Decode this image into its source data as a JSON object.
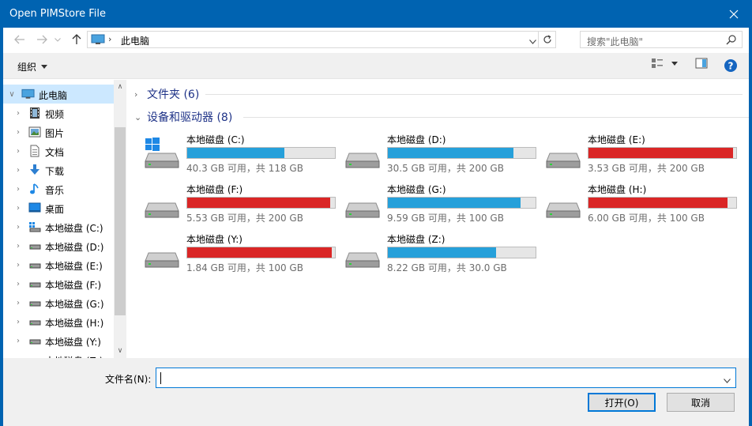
{
  "window": {
    "title": "Open PIMStore File"
  },
  "nav": {
    "path": "此电脑",
    "search_placeholder": "搜索\"此电脑\""
  },
  "toolbar": {
    "organize": "组织"
  },
  "sidebar": {
    "items": [
      {
        "label": "此电脑",
        "icon": "pc-icon",
        "expand": "open"
      },
      {
        "label": "视频",
        "icon": "video-icon"
      },
      {
        "label": "图片",
        "icon": "picture-icon"
      },
      {
        "label": "文档",
        "icon": "document-icon"
      },
      {
        "label": "下载",
        "icon": "download-icon"
      },
      {
        "label": "音乐",
        "icon": "music-icon"
      },
      {
        "label": "桌面",
        "icon": "desktop-icon"
      },
      {
        "label": "本地磁盘 (C:)",
        "icon": "system-drive-icon"
      },
      {
        "label": "本地磁盘 (D:)",
        "icon": "drive-icon"
      },
      {
        "label": "本地磁盘 (E:)",
        "icon": "drive-icon"
      },
      {
        "label": "本地磁盘 (F:)",
        "icon": "drive-icon"
      },
      {
        "label": "本地磁盘 (G:)",
        "icon": "drive-icon"
      },
      {
        "label": "本地磁盘 (H:)",
        "icon": "drive-icon"
      },
      {
        "label": "本地磁盘 (Y:)",
        "icon": "drive-icon"
      },
      {
        "label": "本地磁盘 (Z:)",
        "icon": "drive-icon"
      }
    ]
  },
  "groups": {
    "folders": "文件夹 (6)",
    "drives": "设备和驱动器 (8)"
  },
  "drives": [
    {
      "name": "本地磁盘 (C:)",
      "info": "40.3 GB 可用，共 118 GB",
      "used_fraction": 0.66,
      "status": "normal",
      "system": true
    },
    {
      "name": "本地磁盘 (D:)",
      "info": "30.5 GB 可用，共 200 GB",
      "used_fraction": 0.85,
      "status": "normal"
    },
    {
      "name": "本地磁盘 (E:)",
      "info": "3.53 GB 可用，共 200 GB",
      "used_fraction": 0.98,
      "status": "full"
    },
    {
      "name": "本地磁盘 (F:)",
      "info": "5.53 GB 可用，共 200 GB",
      "used_fraction": 0.97,
      "status": "full"
    },
    {
      "name": "本地磁盘 (G:)",
      "info": "9.59 GB 可用，共 100 GB",
      "used_fraction": 0.9,
      "status": "normal"
    },
    {
      "name": "本地磁盘 (H:)",
      "info": "6.00 GB 可用，共 100 GB",
      "used_fraction": 0.94,
      "status": "full"
    },
    {
      "name": "本地磁盘 (Y:)",
      "info": "1.84 GB 可用，共 100 GB",
      "used_fraction": 0.98,
      "status": "full"
    },
    {
      "name": "本地磁盘 (Z:)",
      "info": "8.22 GB 可用，共 30.0 GB",
      "used_fraction": 0.73,
      "status": "normal"
    }
  ],
  "colors": {
    "normal": "#26a0da",
    "full": "#da2626",
    "title_bar": "#0063b1",
    "group_text": "#1e3287"
  },
  "filename": {
    "label": "文件名(N):",
    "value": ""
  },
  "buttons": {
    "open": "打开(O)",
    "cancel": "取消"
  }
}
